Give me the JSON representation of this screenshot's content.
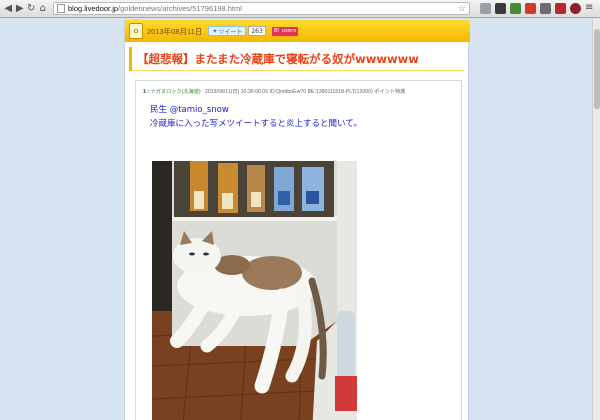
{
  "browser": {
    "url_host": "blog.livedoor.jp",
    "url_path": "/goldennews/archives/51796198.html",
    "back_icon": "back-arrow-icon",
    "forward_icon": "forward-arrow-icon",
    "reload_icon": "reload-icon",
    "home_icon": "home-icon"
  },
  "blog": {
    "date": "2013年08月11日",
    "tweet_label": "ツイート",
    "tweet_count": "263",
    "hatena_label": "B! users"
  },
  "article": {
    "title": "【超悲報】またまた冷蔵庫で寝転がる奴がwwwwww",
    "res_number": "1 :",
    "res_name": "ナガヌロック(北海道)",
    "res_meta": ": 2013/08/11(日) 10:36:00.09 ID:QmdbnEw70 BE:1380111518-PLT(12000) ポイント特典",
    "quote_line1": "民生 @tamio_snow",
    "quote_line2": "冷蔵庫に入った写メツイートすると炎上すると聞いて。"
  },
  "colors": {
    "accent": "#f5b800",
    "title": "#e8441c",
    "quote": "#2222cc"
  }
}
